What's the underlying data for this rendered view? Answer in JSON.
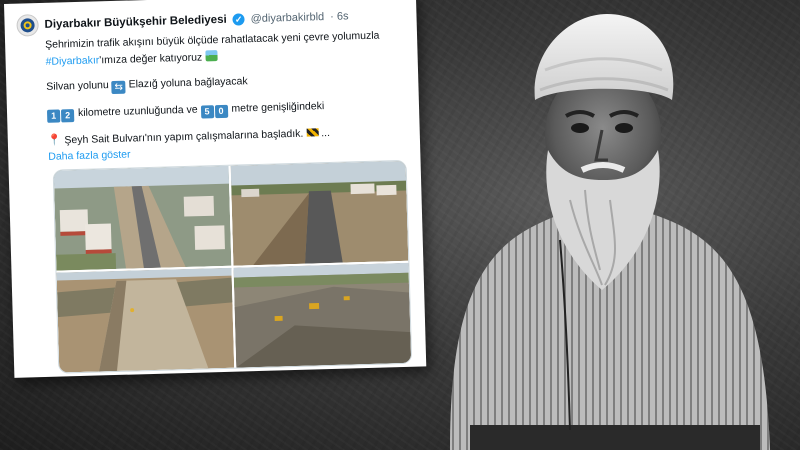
{
  "tweet": {
    "author_name": "Diyarbakır Büyükşehir Belediyesi",
    "handle": "@diyarbakirbld",
    "time": "· 6s",
    "line1_text": "Şehrimizin trafik akışını büyük ölçüde rahatlatacak yeni çevre yolumuzla",
    "hashtag": "#Diyarbakır",
    "line2_rest": "'ımıza değer katıyoruz",
    "route_from": "Silvan yolunu",
    "route_to": "Elazığ yoluna bağlayacak",
    "length_digit1": "1",
    "length_digit2": "2",
    "length_text": "kilometre uzunluğunda ve",
    "width_digit1": "5",
    "width_digit2": "0",
    "width_text": "metre genişliğindeki",
    "works_text": "Şeyh Sait Bulvarı'nın yapım çalışmalarına başladık.",
    "ellipsis": "...",
    "show_more": "Daha fazla göster"
  },
  "icons": {
    "verified": "verified-badge-icon",
    "route": "left-right-arrows-icon",
    "pin": "round-pushpin-icon",
    "barrier": "construction-barrier-icon",
    "landscape": "national-park-icon"
  },
  "colors": {
    "link": "#1d9bf0",
    "keycap": "#3b88c3",
    "handle": "#536471"
  }
}
